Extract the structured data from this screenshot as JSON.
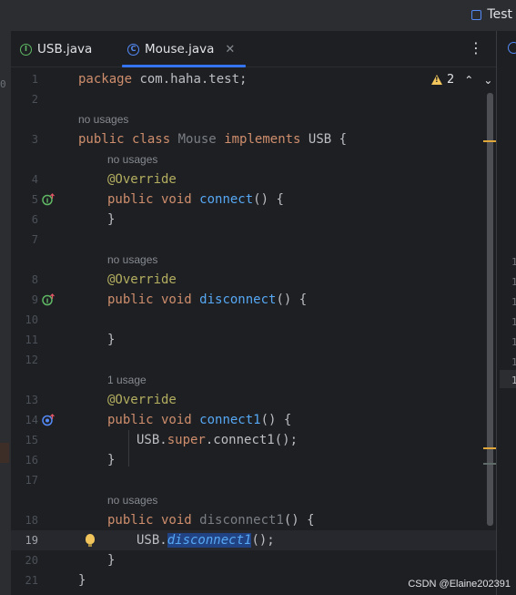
{
  "window": {
    "run_config": "Test"
  },
  "left_strip": {
    "char": "0"
  },
  "tabs": [
    {
      "label": "USB.java",
      "icon": "interface-icon"
    },
    {
      "label": "Mouse.java",
      "icon": "class-icon",
      "active": true
    }
  ],
  "inspection": {
    "warning_count": "2"
  },
  "lines": [
    {
      "n": "1",
      "code": "package com.haha.test;"
    },
    {
      "n": "2"
    },
    {
      "hint": "no usages"
    },
    {
      "n": "3",
      "code": "public class Mouse implements USB {"
    },
    {
      "hint": "no usages"
    },
    {
      "n": "4",
      "code": "@Override"
    },
    {
      "n": "5",
      "code": "public void connect() {"
    },
    {
      "n": "6",
      "code": "}"
    },
    {
      "n": "7"
    },
    {
      "hint": "no usages"
    },
    {
      "n": "8",
      "code": "@Override"
    },
    {
      "n": "9",
      "code": "public void disconnect() {"
    },
    {
      "n": "10"
    },
    {
      "n": "11",
      "code": "}"
    },
    {
      "n": "12"
    },
    {
      "hint": "1 usage"
    },
    {
      "n": "13",
      "code": "@Override"
    },
    {
      "n": "14",
      "code": "public void connect1() {"
    },
    {
      "n": "15",
      "code": "USB.super.connect1();"
    },
    {
      "n": "16",
      "code": "}"
    },
    {
      "n": "17"
    },
    {
      "hint": "no usages"
    },
    {
      "n": "18",
      "code": "public void disconnect1() {"
    },
    {
      "n": "19",
      "code": "USB.disconnect1();"
    },
    {
      "n": "20",
      "code": "}"
    },
    {
      "n": "21",
      "code": "}"
    }
  ],
  "right_panel": {
    "line_numbers": [
      "1",
      "1",
      "1",
      "1",
      "1",
      "1",
      "1",
      "1"
    ]
  },
  "watermark": "CSDN @Elaine202391",
  "colors": {
    "accent": "#3574f0",
    "keyword": "#cf8e6d",
    "method": "#56a8f5",
    "annotation": "#b3ae60",
    "warning": "#f2c55c"
  }
}
